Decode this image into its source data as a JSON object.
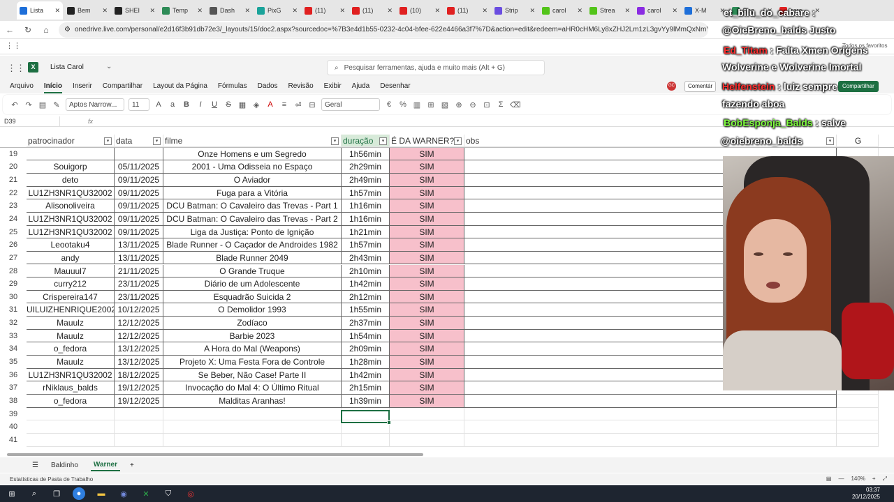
{
  "browser": {
    "tabs": [
      {
        "label": "Lista",
        "color": "#1e6fd9",
        "active": true
      },
      {
        "label": "Bem",
        "color": "#222222"
      },
      {
        "label": "SHEI",
        "color": "#222222"
      },
      {
        "label": "Temp",
        "color": "#2e8b57"
      },
      {
        "label": "Dash",
        "color": "#555555"
      },
      {
        "label": "PixG",
        "color": "#1aa39a"
      },
      {
        "label": "(11)",
        "color": "#e02020"
      },
      {
        "label": "(11)",
        "color": "#e02020"
      },
      {
        "label": "(10)",
        "color": "#e02020"
      },
      {
        "label": "(11)",
        "color": "#e02020"
      },
      {
        "label": "Strip",
        "color": "#6a4de0"
      },
      {
        "label": "carol",
        "color": "#53c41a"
      },
      {
        "label": "Strea",
        "color": "#53c41a"
      },
      {
        "label": "carol",
        "color": "#8a2be2"
      },
      {
        "label": "X-M",
        "color": "#1e6fd9"
      },
      {
        "label": "Goo",
        "color": "#2e8b57"
      },
      {
        "label": "caro",
        "color": "#e02020"
      }
    ],
    "url": "onedrive.live.com/personal/e2d16f3b91db72e3/_layouts/15/doc2.aspx?sourcedoc=%7B3e4d1b55-0232-4c04-bfee-622e4466a3f7%7D&action=edit&redeem=aHR0cHM6Ly8xZHJ2Lm1zL3gvYy9lMmQxNmYzYjkxZGI3MmU",
    "favorites_label": "Todos os favoritos"
  },
  "excel": {
    "workbook_name": "Lista Carol",
    "search_placeholder": "Pesquisar ferramentas, ajuda e muito mais (Alt + G)",
    "user_initials": "GC",
    "menu": [
      "Arquivo",
      "Início",
      "Inserir",
      "Compartilhar",
      "Layout da Página",
      "Fórmulas",
      "Dados",
      "Revisão",
      "Exibir",
      "Ajuda",
      "Desenhar"
    ],
    "comments_label": "Comentár",
    "share_label": "Compartilhar",
    "font_name": "Aptos Narrow...",
    "font_size": "11",
    "number_format": "Geral",
    "name_box": "D39",
    "fx_label": "fx"
  },
  "sheet": {
    "headers": [
      "patrocinador",
      "data",
      "filme",
      "duração",
      "É DA WARNER?",
      "obs",
      "G"
    ],
    "rows": [
      {
        "n": "19",
        "sponsor": "",
        "date": "",
        "film": "Onze Homens e um Segredo",
        "dur": "1h56min",
        "warner": "SIM"
      },
      {
        "n": "20",
        "sponsor": "Souigorp",
        "date": "05/11/2025",
        "film": "2001 - Uma Odisseia no Espaço",
        "dur": "2h29min",
        "warner": "SIM"
      },
      {
        "n": "21",
        "sponsor": "deto",
        "date": "09/11/2025",
        "film": "O Aviador",
        "dur": "2h49min",
        "warner": "SIM"
      },
      {
        "n": "22",
        "sponsor": "LU1ZH3NR1QU32002",
        "date": "09/11/2025",
        "film": "Fuga para a Vitória",
        "dur": "1h57min",
        "warner": "SIM"
      },
      {
        "n": "23",
        "sponsor": "Alisonoliveira",
        "date": "09/11/2025",
        "film": "DCU Batman: O Cavaleiro das Trevas - Part 1",
        "dur": "1h16min",
        "warner": "SIM"
      },
      {
        "n": "24",
        "sponsor": "LU1ZH3NR1QU32002",
        "date": "09/11/2025",
        "film": "DCU Batman: O Cavaleiro das Trevas - Part 2",
        "dur": "1h16min",
        "warner": "SIM"
      },
      {
        "n": "25",
        "sponsor": "LU1ZH3NR1QU32002",
        "date": "09/11/2025",
        "film": "Liga da Justiça: Ponto de Ignição",
        "dur": "1h21min",
        "warner": "SIM"
      },
      {
        "n": "26",
        "sponsor": "Leootaku4",
        "date": "13/11/2025",
        "film": "Blade Runner - O Caçador de Androides 1982",
        "dur": "1h57min",
        "warner": "SIM"
      },
      {
        "n": "27",
        "sponsor": "andy",
        "date": "13/11/2025",
        "film": "Blade Runner 2049",
        "dur": "2h43min",
        "warner": "SIM"
      },
      {
        "n": "28",
        "sponsor": "Mauuul7",
        "date": "21/11/2025",
        "film": "O Grande Truque",
        "dur": "2h10min",
        "warner": "SIM"
      },
      {
        "n": "29",
        "sponsor": "curry212",
        "date": "23/11/2025",
        "film": "Diário de um Adolescente",
        "dur": "1h42min",
        "warner": "SIM"
      },
      {
        "n": "30",
        "sponsor": "Crispereira147",
        "date": "23/11/2025",
        "film": "Esquadrão Suicida 2",
        "dur": "2h12min",
        "warner": "SIM"
      },
      {
        "n": "31",
        "sponsor": "UILUIZHENRIQUE2002",
        "date": "10/12/2025",
        "film": "O Demolidor 1993",
        "dur": "1h55min",
        "warner": "SIM"
      },
      {
        "n": "32",
        "sponsor": "Mauulz",
        "date": "12/12/2025",
        "film": "Zodíaco",
        "dur": "2h37min",
        "warner": "SIM"
      },
      {
        "n": "33",
        "sponsor": "Mauulz",
        "date": "12/12/2025",
        "film": "Barbie 2023",
        "dur": "1h54min",
        "warner": "SIM"
      },
      {
        "n": "34",
        "sponsor": "o_fedora",
        "date": "13/12/2025",
        "film": "A Hora do Mal (Weapons)",
        "dur": "2h09min",
        "warner": "SIM"
      },
      {
        "n": "35",
        "sponsor": "Mauulz",
        "date": "13/12/2025",
        "film": "Projeto X: Uma Festa Fora de Controle",
        "dur": "1h28min",
        "warner": "SIM"
      },
      {
        "n": "36",
        "sponsor": "LU1ZH3NR1QU32002",
        "date": "18/12/2025",
        "film": "Se Beber, Não Case! Parte II",
        "dur": "1h42min",
        "warner": "SIM"
      },
      {
        "n": "37",
        "sponsor": "rNiklaus_balds",
        "date": "19/12/2025",
        "film": "Invocação do Mal 4: O Último Ritual",
        "dur": "2h15min",
        "warner": "SIM"
      },
      {
        "n": "38",
        "sponsor": "o_fedora",
        "date": "19/12/2025",
        "film": "Malditas Aranhas!",
        "dur": "1h39min",
        "warner": "SIM"
      },
      {
        "n": "39",
        "sponsor": "",
        "date": "",
        "film": "",
        "dur": "",
        "warner": ""
      },
      {
        "n": "40",
        "sponsor": "",
        "date": "",
        "film": "",
        "dur": "",
        "warner": ""
      },
      {
        "n": "41",
        "sponsor": "",
        "date": "",
        "film": "",
        "dur": "",
        "warner": ""
      }
    ],
    "tabs": [
      "Baldinho",
      "Warner"
    ],
    "active_tab": "Warner",
    "status_text": "Estatísticas de Pasta de Trabalho",
    "zoom": "140%"
  },
  "overlay_chat": [
    {
      "user": "et_bilu_do_cabare",
      "msg": ":",
      "user_color": "#ffffff"
    },
    {
      "user": "@OieBreno_balds Justo",
      "msg": "",
      "user_color": "#ffffff"
    },
    {
      "user": "Ed_Titam",
      "msg": ": Falta Xmen Origens",
      "user_color": "#ff3030"
    },
    {
      "user": "Wolverine e Wolverine Imortal",
      "msg": "",
      "user_color": "#ffffff"
    },
    {
      "user": "Helfenstein",
      "msg": ": luiz sempre",
      "user_color": "#ff3030"
    },
    {
      "user": "fazendo aboa",
      "msg": "",
      "user_color": "#ffffff"
    },
    {
      "user": "BobEsponja_Balds",
      "msg": ": salve",
      "user_color": "#80ff40"
    },
    {
      "user": "@oiebreno_balds",
      "msg": "",
      "user_color": "#ffffff"
    }
  ],
  "taskbar": {
    "time": "03:37",
    "date": "20/12/2025"
  }
}
